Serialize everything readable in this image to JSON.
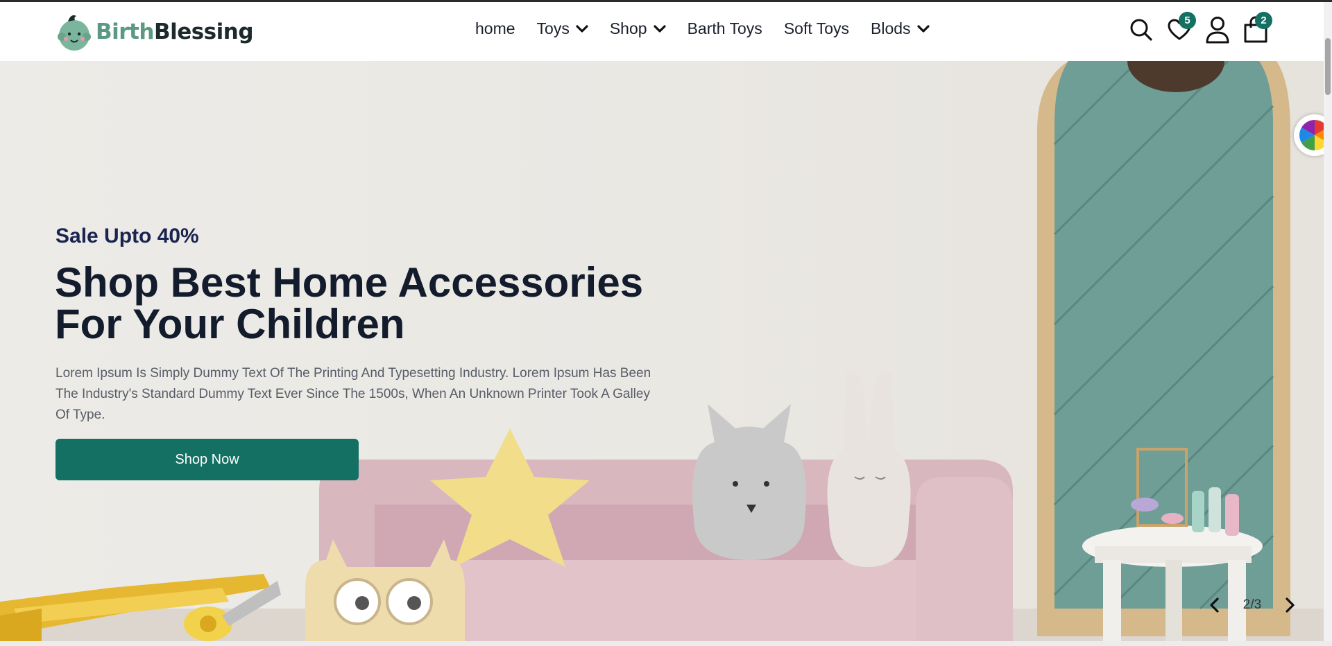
{
  "header": {
    "logo": {
      "part1": "Birth",
      "part2": "Blessing"
    },
    "nav": [
      {
        "label": "home",
        "dropdown": false
      },
      {
        "label": "Toys",
        "dropdown": true
      },
      {
        "label": "Shop",
        "dropdown": true
      },
      {
        "label": "Barth Toys",
        "dropdown": false
      },
      {
        "label": "Soft Toys",
        "dropdown": false
      },
      {
        "label": "Blods",
        "dropdown": true
      }
    ],
    "wishlist_count": "5",
    "cart_count": "2"
  },
  "hero": {
    "sale": "Sale Upto 40%",
    "headline_line1": "Shop Best Home Accessories",
    "headline_line2": "For Your Children",
    "description": "Lorem Ipsum Is Simply Dummy Text Of The Printing And Typesetting Industry. Lorem Ipsum Has Been The Industry's Standard Dummy Text Ever Since The 1500s, When An Unknown Printer Took A Galley Of Type.",
    "cta": "Shop Now",
    "slide_indicator": "2/3"
  },
  "icons": {
    "search": "search-icon",
    "wishlist": "heart-icon",
    "account": "user-icon",
    "cart": "shopping-bag-icon"
  },
  "colors": {
    "brand_green": "#137063",
    "logo_green": "#5a9a83",
    "headline": "#131c2c",
    "sale_text": "#1a2450"
  }
}
